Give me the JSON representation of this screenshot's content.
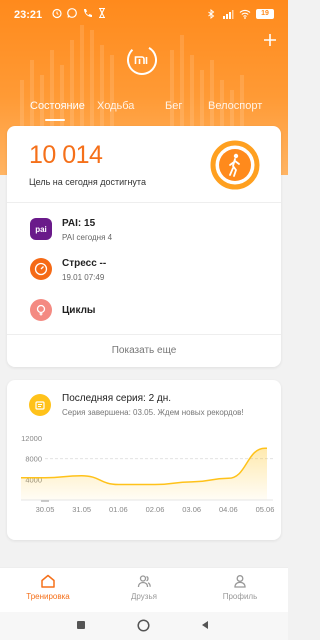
{
  "status_bar": {
    "time": "23:21",
    "battery": "19"
  },
  "tabs": [
    {
      "label": "Состояние",
      "active": true
    },
    {
      "label": "Ходьба",
      "active": false
    },
    {
      "label": "Бег",
      "active": false
    },
    {
      "label": "Велоспорт",
      "active": false
    }
  ],
  "summary": {
    "steps": "10 014",
    "goal_text": "Цель на сегодня достигнута",
    "metrics": [
      {
        "title": "PAI: 15",
        "subtitle": "PAI сегодня 4",
        "icon_label": "pai",
        "icon": "pai-icon"
      },
      {
        "title": "Стресс --",
        "subtitle": "19.01 07:49",
        "icon": "stress-gauge-icon"
      },
      {
        "title": "Циклы",
        "subtitle": "",
        "icon": "cycle-icon"
      }
    ],
    "show_more": "Показать еще"
  },
  "streak": {
    "title": "Последняя серия: 2 дн.",
    "subtitle": "Серия завершена: 03.05. Ждем новых рекордов!"
  },
  "chart_data": {
    "type": "area",
    "x": [
      "30.05",
      "31.05",
      "01.06",
      "02.06",
      "03.06",
      "04.06",
      "05.06"
    ],
    "values": [
      4300,
      4700,
      3000,
      3000,
      3500,
      4200,
      10014
    ],
    "y_ticks": [
      "12000",
      "8000",
      "4000"
    ],
    "ylim": [
      0,
      12000
    ],
    "goal_line": 8000,
    "color": "#ffc21a"
  },
  "bottom_nav": [
    {
      "label": "Тренировка",
      "active": true,
      "icon": "home-icon"
    },
    {
      "label": "Друзья",
      "active": false,
      "icon": "friends-icon"
    },
    {
      "label": "Профиль",
      "active": false,
      "icon": "profile-icon"
    }
  ],
  "colors": {
    "accent": "#f5701a",
    "header": "#ff8a1c",
    "pai": "#6a1a8a",
    "streak": "#ffc21a"
  }
}
